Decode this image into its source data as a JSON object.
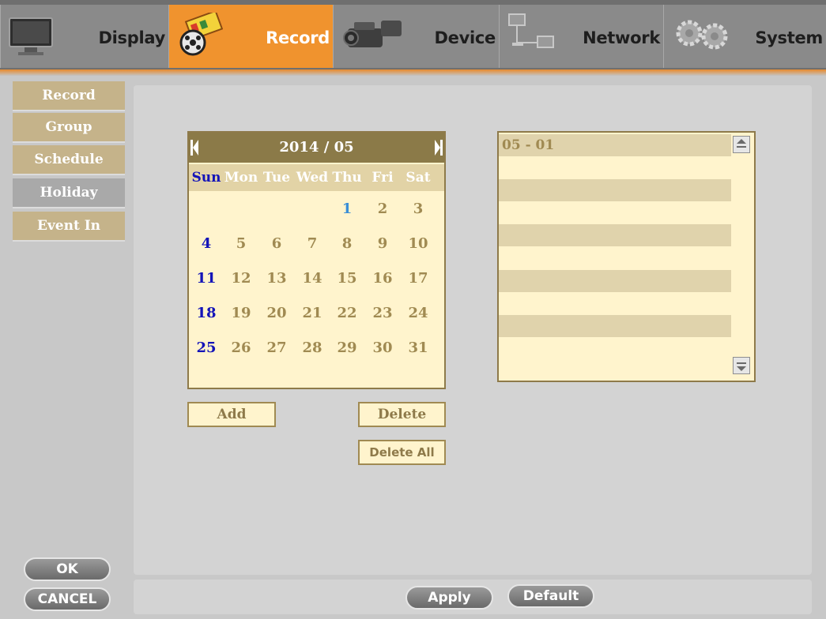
{
  "nav": {
    "tabs": [
      {
        "label": "Display",
        "icon": "monitor-icon"
      },
      {
        "label": "Record",
        "icon": "film-reel-icon",
        "active": true
      },
      {
        "label": "Device",
        "icon": "camcorder-icon"
      },
      {
        "label": "Network",
        "icon": "network-icon"
      },
      {
        "label": "System",
        "icon": "gears-icon"
      }
    ]
  },
  "sidebar": {
    "items": [
      {
        "label": "Record"
      },
      {
        "label": "Group"
      },
      {
        "label": "Schedule"
      },
      {
        "label": "Holiday",
        "active": true
      },
      {
        "label": "Event In"
      }
    ]
  },
  "calendar": {
    "month_label": "2014 / 05",
    "weekdays": [
      "Sun",
      "Mon",
      "Tue",
      "Wed",
      "Thu",
      "Fri",
      "Sat"
    ],
    "weeks": [
      [
        "",
        "",
        "",
        "",
        "1",
        "2",
        "3"
      ],
      [
        "4",
        "5",
        "6",
        "7",
        "8",
        "9",
        "10"
      ],
      [
        "11",
        "12",
        "13",
        "14",
        "15",
        "16",
        "17"
      ],
      [
        "18",
        "19",
        "20",
        "21",
        "22",
        "23",
        "24"
      ],
      [
        "25",
        "26",
        "27",
        "28",
        "29",
        "30",
        "31"
      ]
    ],
    "highlighted_day": "1",
    "prev_icon": "triangle-left-icon",
    "next_icon": "triangle-right-icon"
  },
  "actions": {
    "add_label": "Add",
    "delete_label": "Delete",
    "delete_all_label": "Delete All"
  },
  "holiday_list": {
    "entries": [
      "05 - 01",
      "",
      "",
      "",
      "",
      "",
      "",
      "",
      "",
      ""
    ]
  },
  "footer": {
    "ok_label": "OK",
    "cancel_label": "CANCEL",
    "apply_label": "Apply",
    "default_label": "Default"
  },
  "colors": {
    "accent_orange": "#f0932e",
    "panel_tan": "#c5b38a",
    "calendar_bg": "#fff4cd",
    "sunday_blue": "#1414b8"
  }
}
